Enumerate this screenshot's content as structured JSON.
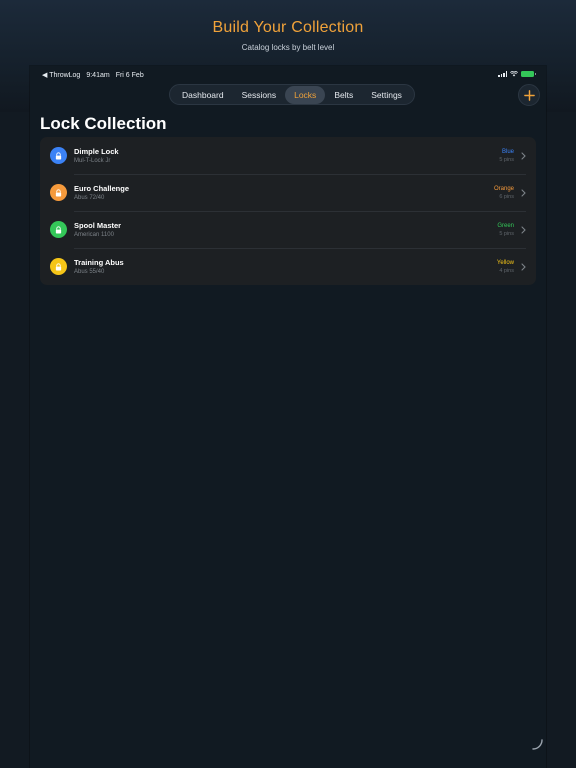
{
  "promo": {
    "title": "Build Your Collection",
    "subtitle": "Catalog locks by belt level"
  },
  "status_bar": {
    "back_app": "◀ ThrowLog",
    "time": "9:41am",
    "date": "Fri 6 Feb"
  },
  "tabs": [
    {
      "label": "Dashboard",
      "active": false
    },
    {
      "label": "Sessions",
      "active": false
    },
    {
      "label": "Locks",
      "active": true
    },
    {
      "label": "Belts",
      "active": false
    },
    {
      "label": "Settings",
      "active": false
    }
  ],
  "add_button": {
    "icon": "plus-icon",
    "color": "#f0a23a"
  },
  "page_title": "Lock Collection",
  "locks": [
    {
      "name": "Dimple Lock",
      "model": "Mul-T-Lock Jr",
      "belt": "Blue",
      "pins": "5 pins",
      "color": "#3b82f6"
    },
    {
      "name": "Euro Challenge",
      "model": "Abus 72/40",
      "belt": "Orange",
      "pins": "6 pins",
      "color": "#f59a3c"
    },
    {
      "name": "Spool Master",
      "model": "American 1100",
      "belt": "Green",
      "pins": "5 pins",
      "color": "#34c759"
    },
    {
      "name": "Training Abus",
      "model": "Abus 55/40",
      "belt": "Yellow",
      "pins": "4 pins",
      "color": "#f5c518"
    }
  ],
  "colors": {
    "accent": "#f0a23a",
    "background": "#111a22",
    "card": "#1d2023"
  }
}
